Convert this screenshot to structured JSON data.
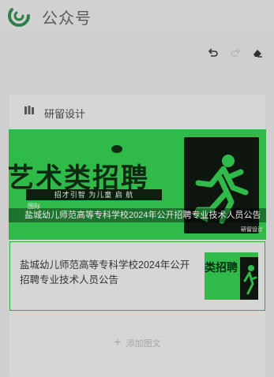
{
  "header": {
    "title": "公众号",
    "logo_icon": "wechat-official-account-logo-icon"
  },
  "toolbar": {
    "undo_icon": "undo-icon",
    "redo_icon": "redo-icon",
    "clear_icon": "eraser-icon"
  },
  "account": {
    "name": "研留设计",
    "icon": "account-logo-icon"
  },
  "banner": {
    "headline": "艺术类招聘",
    "subline": "招才引智 为儿童 启 航",
    "caption": "盐城幼儿师范高等专科学校2024年公开招聘专业技术人员公告",
    "mark": "国际",
    "watermark": "研留设计"
  },
  "article": {
    "title": "盐城幼儿师范高等专科学校2024年公开招聘专业技术人员公告",
    "thumb_text": "类招聘"
  },
  "add": {
    "label": "添加图文"
  },
  "colors": {
    "accent_green": "#2fba49",
    "dark": "#0f1610",
    "background": "#cfcfcf"
  }
}
